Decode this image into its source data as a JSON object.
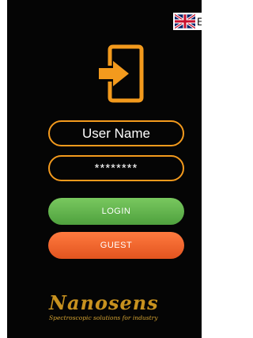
{
  "language": {
    "code": "EN",
    "flag": "uk-flag-icon"
  },
  "header_icon": "login-icon",
  "form": {
    "username_placeholder": "User Name",
    "password_value": "********"
  },
  "buttons": {
    "login_label": "LOGIN",
    "guest_label": "GUEST"
  },
  "brand": {
    "name": "Nanosens",
    "tagline": "Spectroscopic solutions for industry"
  },
  "colors": {
    "background": "#050505",
    "accent_orange": "#f39a1d",
    "login_green": "#5cb548",
    "guest_orange": "#f0622b",
    "brand_gold": "#c8921f"
  }
}
